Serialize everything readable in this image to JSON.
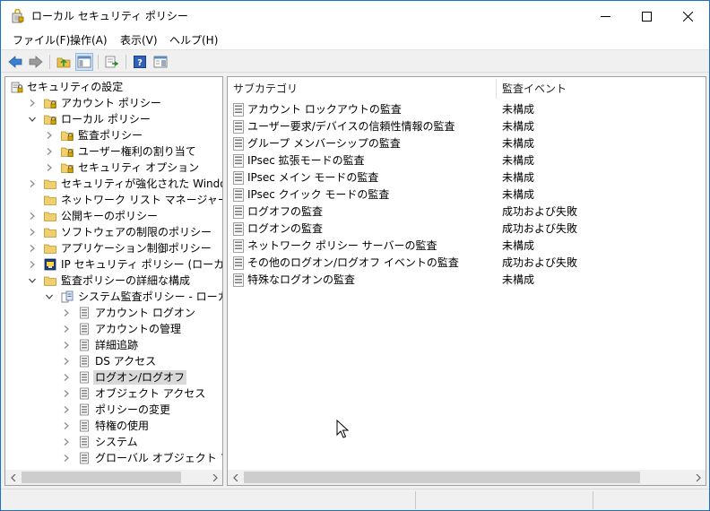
{
  "window": {
    "title": "ローカル セキュリティ ポリシー",
    "controls": {
      "minimize": "minimize",
      "maximize": "maximize",
      "close": "close"
    }
  },
  "menu": {
    "items": [
      {
        "label": "ファイル(F)"
      },
      {
        "label": "操作(A)"
      },
      {
        "label": "表示(V)"
      },
      {
        "label": "ヘルプ(H)"
      }
    ]
  },
  "toolbar": {
    "icons": [
      "back-arrow-icon",
      "forward-arrow-icon",
      "up-folder-icon",
      "show-hide-tree-icon",
      "export-list-icon",
      "help-icon",
      "properties-pane-icon"
    ]
  },
  "tree": {
    "items": [
      {
        "label": "セキュリティの設定",
        "level": 0,
        "expander": "none",
        "icon": "security-settings-icon"
      },
      {
        "label": "アカウント ポリシー",
        "level": 1,
        "expander": "collapsed",
        "icon": "folder-lock-icon"
      },
      {
        "label": "ローカル ポリシー",
        "level": 1,
        "expander": "expanded",
        "icon": "folder-lock-icon"
      },
      {
        "label": "監査ポリシー",
        "level": 2,
        "expander": "collapsed",
        "icon": "folder-lock-icon"
      },
      {
        "label": "ユーザー権利の割り当て",
        "level": 2,
        "expander": "collapsed",
        "icon": "folder-lock-icon"
      },
      {
        "label": "セキュリティ オプション",
        "level": 2,
        "expander": "collapsed",
        "icon": "folder-lock-icon"
      },
      {
        "label": "セキュリティが強化された Windows ファイア",
        "level": 1,
        "expander": "collapsed",
        "icon": "folder-icon"
      },
      {
        "label": "ネットワーク リスト マネージャー ポリシー",
        "level": 1,
        "expander": "none",
        "icon": "folder-icon"
      },
      {
        "label": "公開キーのポリシー",
        "level": 1,
        "expander": "collapsed",
        "icon": "folder-icon"
      },
      {
        "label": "ソフトウェアの制限のポリシー",
        "level": 1,
        "expander": "collapsed",
        "icon": "folder-icon"
      },
      {
        "label": "アプリケーション制御ポリシー",
        "level": 1,
        "expander": "collapsed",
        "icon": "folder-icon"
      },
      {
        "label": "IP セキュリティ ポリシー (ローカル コンピュータ",
        "level": 1,
        "expander": "collapsed",
        "icon": "ip-security-icon"
      },
      {
        "label": "監査ポリシーの詳細な構成",
        "level": 1,
        "expander": "expanded",
        "icon": "folder-icon"
      },
      {
        "label": "システム監査ポリシー - ローカル グループ",
        "level": 2,
        "expander": "expanded",
        "icon": "audit-policy-icon"
      },
      {
        "label": "アカウント ログオン",
        "level": 3,
        "expander": "collapsed",
        "icon": "policy-doc-icon"
      },
      {
        "label": "アカウントの管理",
        "level": 3,
        "expander": "collapsed",
        "icon": "policy-doc-icon"
      },
      {
        "label": "詳細追跡",
        "level": 3,
        "expander": "collapsed",
        "icon": "policy-doc-icon"
      },
      {
        "label": "DS アクセス",
        "level": 3,
        "expander": "collapsed",
        "icon": "policy-doc-icon"
      },
      {
        "label": "ログオン/ログオフ",
        "level": 3,
        "expander": "collapsed",
        "icon": "policy-doc-icon",
        "selected": true
      },
      {
        "label": "オブジェクト アクセス",
        "level": 3,
        "expander": "collapsed",
        "icon": "policy-doc-icon"
      },
      {
        "label": "ポリシーの変更",
        "level": 3,
        "expander": "collapsed",
        "icon": "policy-doc-icon"
      },
      {
        "label": "特権の使用",
        "level": 3,
        "expander": "collapsed",
        "icon": "policy-doc-icon"
      },
      {
        "label": "システム",
        "level": 3,
        "expander": "collapsed",
        "icon": "policy-doc-icon"
      },
      {
        "label": "グローバル オブジェクト アクセスの監",
        "level": 3,
        "expander": "collapsed",
        "icon": "policy-doc-icon"
      }
    ]
  },
  "list": {
    "columns": [
      {
        "label": "サブカテゴリ"
      },
      {
        "label": "監査イベント"
      }
    ],
    "rows": [
      {
        "name": "アカウント ロックアウトの監査",
        "value": "未構成"
      },
      {
        "name": "ユーザー要求/デバイスの信頼性情報の監査",
        "value": "未構成"
      },
      {
        "name": "グループ メンバーシップの監査",
        "value": "未構成"
      },
      {
        "name": "IPsec 拡張モードの監査",
        "value": "未構成"
      },
      {
        "name": "IPsec メイン モードの監査",
        "value": "未構成"
      },
      {
        "name": "IPsec クイック モードの監査",
        "value": "未構成"
      },
      {
        "name": "ログオフの監査",
        "value": "成功および失敗"
      },
      {
        "name": "ログオンの監査",
        "value": "成功および失敗"
      },
      {
        "name": "ネットワーク ポリシー サーバーの監査",
        "value": "未構成"
      },
      {
        "name": "その他のログオン/ログオフ イベントの監査",
        "value": "成功および失敗"
      },
      {
        "name": "特殊なログオンの監査",
        "value": "未構成"
      }
    ]
  },
  "colors": {
    "accent": "#1a72c7",
    "selection": "#d9d9d9",
    "chrome": "#f0f0f0"
  }
}
